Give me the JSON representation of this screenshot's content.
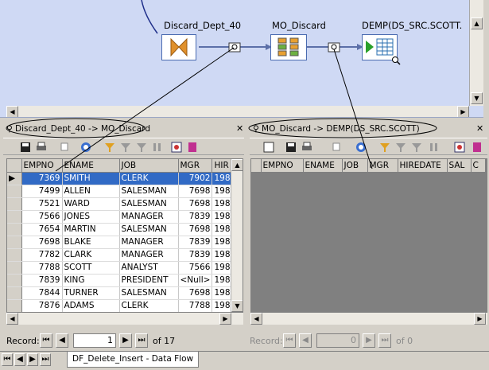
{
  "flow": {
    "nodes": [
      {
        "label": "Discard_Dept_40"
      },
      {
        "label": "MO_Discard"
      },
      {
        "label": "DEMP(DS_SRC.SCOTT."
      }
    ]
  },
  "left_panel": {
    "title": "Discard_Dept_40 -> MO_Discard",
    "columns": [
      "EMPNO",
      "ENAME",
      "JOB",
      "MGR",
      "HIR"
    ],
    "rows": [
      [
        "7369",
        "SMITH",
        "CLERK",
        "7902",
        "198"
      ],
      [
        "7499",
        "ALLEN",
        "SALESMAN",
        "7698",
        "198"
      ],
      [
        "7521",
        "WARD",
        "SALESMAN",
        "7698",
        "198"
      ],
      [
        "7566",
        "JONES",
        "MANAGER",
        "7839",
        "198"
      ],
      [
        "7654",
        "MARTIN",
        "SALESMAN",
        "7698",
        "198"
      ],
      [
        "7698",
        "BLAKE",
        "MANAGER",
        "7839",
        "198"
      ],
      [
        "7782",
        "CLARK",
        "MANAGER",
        "7839",
        "198"
      ],
      [
        "7788",
        "SCOTT",
        "ANALYST",
        "7566",
        "198"
      ],
      [
        "7839",
        "KING",
        "PRESIDENT",
        "<Null>",
        "198"
      ],
      [
        "7844",
        "TURNER",
        "SALESMAN",
        "7698",
        "198"
      ],
      [
        "7876",
        "ADAMS",
        "CLERK",
        "7788",
        "198"
      ]
    ],
    "record_label": "Record:",
    "record_value": "1",
    "record_total": "of 17"
  },
  "right_panel": {
    "title": "MO_Discard -> DEMP(DS_SRC.SCOTT)",
    "columns": [
      "EMPNO",
      "ENAME",
      "JOB",
      "MGR",
      "HIREDATE",
      "SAL",
      "C"
    ],
    "record_label": "Record:",
    "record_value": "0",
    "record_total": "of 0"
  },
  "tab": {
    "label": "DF_Delete_Insert - Data Flow"
  },
  "colors": {
    "canvas": "#cfd9f4",
    "selection": "#316ac5",
    "panel": "#d4d0c8"
  }
}
